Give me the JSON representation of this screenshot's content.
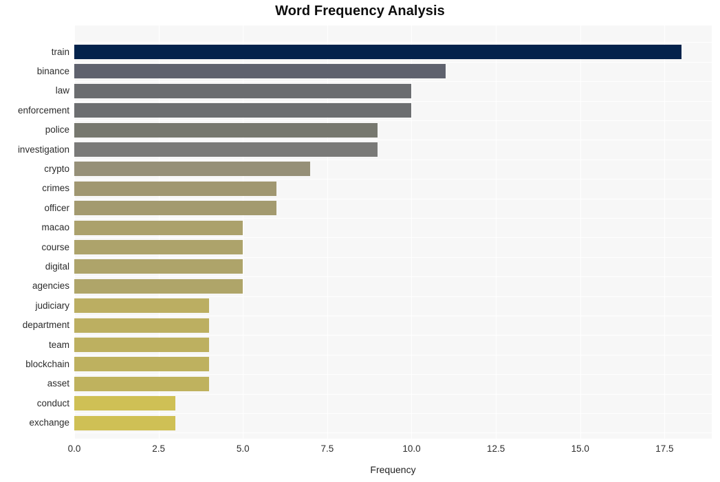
{
  "chart_data": {
    "type": "bar",
    "orientation": "horizontal",
    "title": "Word Frequency Analysis",
    "xlabel": "Frequency",
    "ylabel": "",
    "xlim": [
      0,
      18.9
    ],
    "xticks": [
      0.0,
      2.5,
      5.0,
      7.5,
      10.0,
      12.5,
      15.0,
      17.5
    ],
    "xtick_labels": [
      "0.0",
      "2.5",
      "5.0",
      "7.5",
      "10.0",
      "12.5",
      "15.0",
      "17.5"
    ],
    "grid": true,
    "grid_color": "#ffffff",
    "plot_background": "#f7f7f7",
    "figure_background": "#ffffff",
    "legend": null,
    "categories": [
      "train",
      "binance",
      "law",
      "enforcement",
      "police",
      "investigation",
      "crypto",
      "crimes",
      "officer",
      "macao",
      "course",
      "digital",
      "agencies",
      "judiciary",
      "department",
      "team",
      "blockchain",
      "asset",
      "conduct",
      "exchange"
    ],
    "values": [
      18,
      11,
      10,
      10,
      9,
      9,
      7,
      6,
      6,
      5,
      5,
      5,
      5,
      4,
      4,
      4,
      4,
      4,
      3,
      3
    ],
    "bar_colors": [
      "#04234c",
      "#5f626e",
      "#6b6d70",
      "#6c6e70",
      "#77786f",
      "#7a7a78",
      "#969078",
      "#a09771",
      "#a39a6f",
      "#aba16c",
      "#ada36b",
      "#aea46a",
      "#afa569",
      "#bbae62",
      "#bcaf61",
      "#bdb060",
      "#beb15f",
      "#bfb25e",
      "#cfc055",
      "#cfc055"
    ]
  }
}
